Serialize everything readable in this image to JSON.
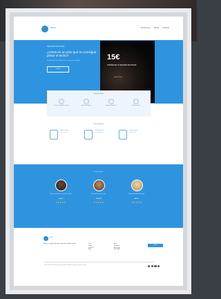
{
  "header": {
    "logo_text": "Muros",
    "nav": [
      "Conóscenos",
      "Tarifas",
      "Contacto"
    ]
  },
  "hero": {
    "kicker": "SEGUROS DE HOGAR",
    "title": "¿Vives en un piso que no consigue pintar el techo?",
    "subtitle": "Te ofrecemos una solución para tu casa y tus muebles",
    "button": "Calcula",
    "offer_price": "15€",
    "offer_text": "AHORRA EN TU SEGURO DE HOGAR",
    "offer_small": "desde 15€/mes"
  },
  "features": {
    "title": "Ventajas Muros",
    "items": [
      "Protección integral de tu hogar",
      "Asistencia 24 horas",
      "Responsabilidad civil",
      "Daños por agua"
    ]
  },
  "how": {
    "title": "Cómo funciona",
    "steps": [
      {
        "title": "Elige tu seguro",
        "sub": "en un minuto"
      },
      {
        "title": "Calcula tu precio",
        "sub": "sin compromiso"
      },
      {
        "title": "Contrata online",
        "sub": "rápido y fácil"
      }
    ]
  },
  "testimonials": {
    "title": "Lo que opinan",
    "items": [
      {
        "quote": "Estoy muy contenta con la atención recibida.",
        "author": "Laura P.",
        "stars": "★★★★★",
        "avatar_color": "#5b3a2a"
      },
      {
        "quote": "El proceso fue rápido y claro.",
        "author": "Carlos M.",
        "stars": "★★★★★",
        "avatar_color": "#8a5a3a"
      },
      {
        "quote": "Muy recomendable para tu hogar.",
        "author": "Ana R.",
        "stars": "★★★★★",
        "avatar_color": "#d7c28a"
      }
    ]
  },
  "footer": {
    "brand": "Muros",
    "about": "Muros es tu seguro de hogar online más sencillo y cercano.",
    "col1": {
      "heading": "Muros",
      "links": [
        "Tarifas",
        "Contacto",
        "Blog"
      ]
    },
    "col2": {
      "heading": "Ayuda",
      "links": [
        "Preguntas",
        "Aviso legal",
        "Privacidad"
      ]
    },
    "cta": "Calcula",
    "legal": "© Muros Seguros. Todos los derechos reservados. Mediador de seguros inscrito en el registro."
  }
}
